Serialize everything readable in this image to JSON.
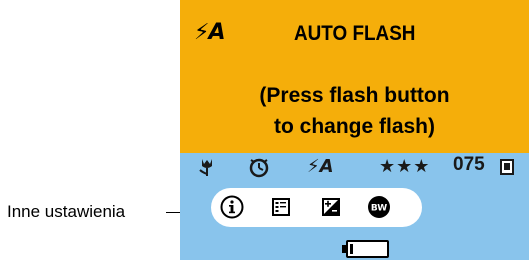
{
  "annotation": {
    "label": "Inne ustawienia"
  },
  "message": {
    "mode_icon": "⚡A",
    "title": "AUTO FLASH",
    "line1": "(Press flash button",
    "line2": "to change flash)"
  },
  "status_bar": {
    "macro_icon": "macro-tulip-icon",
    "self_timer_icon": "self-timer-icon",
    "flash_icon_text": "⚡A",
    "quality_stars": "★★★",
    "picture_count": "075",
    "storage_icon": "memory-card-icon"
  },
  "settings_bar": {
    "icons": [
      "info-icon",
      "date-stamp-icon",
      "exposure-compensation-icon",
      "black-white-color-mode-icon"
    ]
  },
  "battery_icon": "battery-low-icon",
  "colors": {
    "message_bg": "#f5ae0a",
    "status_bg": "#89c4ec",
    "settings_bar_bg": "#ffffff"
  }
}
